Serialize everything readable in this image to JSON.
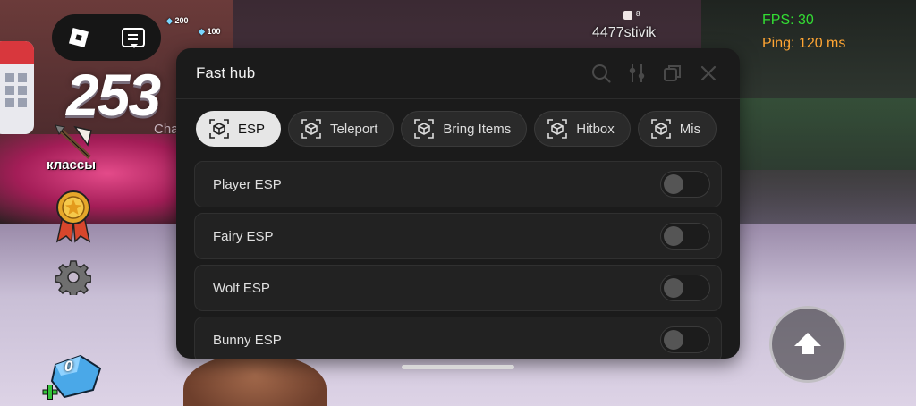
{
  "hub": {
    "title": "Fast hub",
    "tabs": [
      {
        "label": "ESP",
        "active": true
      },
      {
        "label": "Teleport",
        "active": false
      },
      {
        "label": "Bring Items",
        "active": false
      },
      {
        "label": "Hitbox",
        "active": false
      },
      {
        "label": "Mis",
        "active": false
      }
    ],
    "toggles": [
      {
        "label": "Player ESP",
        "on": false
      },
      {
        "label": "Fairy ESP",
        "on": false
      },
      {
        "label": "Wolf ESP",
        "on": false
      },
      {
        "label": "Bunny ESP",
        "on": false
      }
    ]
  },
  "hud": {
    "big_number": "253",
    "cha_text": "Cha",
    "class_label": "классы",
    "gem_count": "0",
    "mini_left": "200",
    "mini_right": "100",
    "player_name": "4477stivik",
    "player_badge": "8",
    "fps_label": "FPS:",
    "fps_value": "30",
    "ping_text": "Ping: 120 ms"
  },
  "colors": {
    "panel_bg": "#1b1b1b",
    "fps_green": "#33dd33",
    "ping_orange": "#ffa533",
    "active_tab": "#e6e6e6"
  },
  "icons": {
    "header": [
      "search-icon",
      "sliders-icon",
      "minimize-icon",
      "close-icon"
    ],
    "tab": "cube-icon"
  }
}
